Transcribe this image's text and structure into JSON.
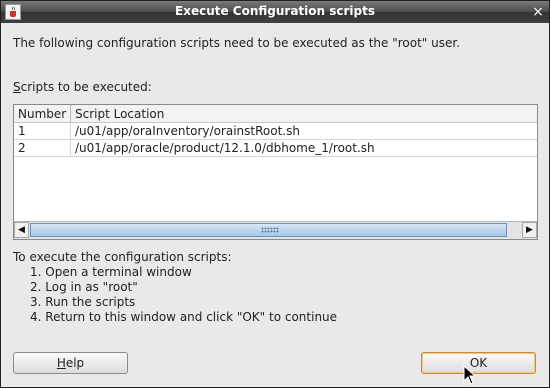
{
  "window": {
    "title": "Execute Configuration scripts",
    "close_glyph": "×"
  },
  "description": "The following configuration scripts need to be executed as the \"root\" user.",
  "scripts_label": {
    "mnemonic": "S",
    "rest": "cripts to be executed:"
  },
  "table": {
    "columns": [
      "Number",
      "Script Location"
    ],
    "rows": [
      {
        "number": "1",
        "location": "/u01/app/oraInventory/orainstRoot.sh"
      },
      {
        "number": "2",
        "location": "/u01/app/oracle/product/12.1.0/dbhome_1/root.sh"
      }
    ]
  },
  "instructions": {
    "heading": "To execute the configuration scripts:",
    "steps": [
      "1. Open a terminal window",
      "2. Log in as \"root\"",
      "3. Run the scripts",
      "4. Return to this window and click \"OK\" to continue"
    ]
  },
  "buttons": {
    "help": {
      "mnemonic": "H",
      "rest": "elp"
    },
    "ok": "OK"
  },
  "icons": {
    "app": "java-cup-icon",
    "close": "close-icon",
    "scroll_left": "arrow-left-icon",
    "scroll_right": "arrow-right-icon",
    "cursor": "mouse-pointer-icon"
  },
  "colors": {
    "titlebar": "#3f3f3f",
    "scroll_thumb": "#a9c6e6",
    "ok_focus_border": "#c98a3a"
  }
}
